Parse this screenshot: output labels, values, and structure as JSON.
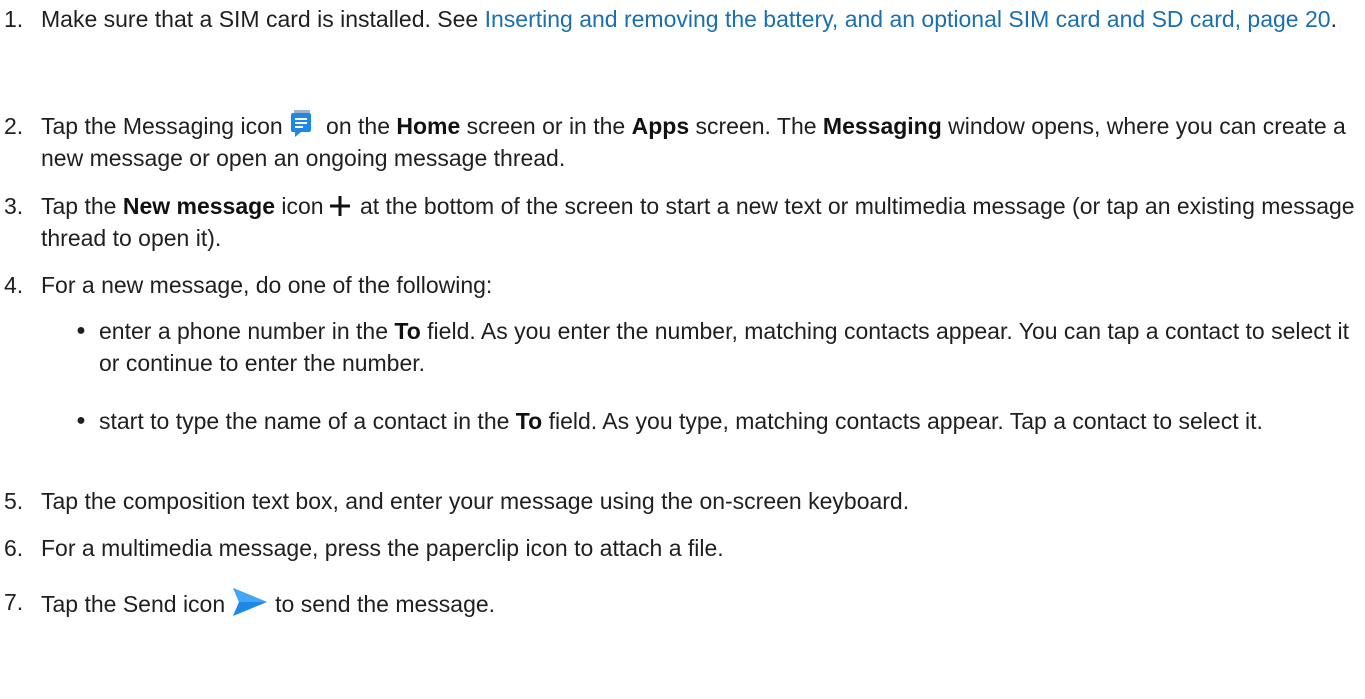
{
  "steps": {
    "s1": {
      "num": "1.",
      "text_a": "Make sure that a SIM card is installed.  See ",
      "link": "Inserting and removing the battery, and an optional SIM card and SD card, page 20",
      "text_b": "."
    },
    "s2": {
      "num": "2.",
      "t1": "Tap the Messaging icon",
      "t2": " on the ",
      "b1": "Home",
      "t3": " screen or in the ",
      "b2": "Apps",
      "t4": " screen. The ",
      "b3": "Messaging",
      "t5": " window opens, where you can create a new message or open an ongoing message thread."
    },
    "s3": {
      "num": "3.",
      "t1": "Tap the ",
      "b1": "New message",
      "t2": " icon",
      "t3": " at the bottom of the screen to start a new text or multimedia message (or tap an existing message thread to open it)."
    },
    "s4": {
      "num": "4.",
      "text": "For a new message, do one of the following:",
      "bullets": [
        {
          "t1": "enter a phone number in the ",
          "b1": "To",
          "t2": " field. As you enter the number, matching contacts appear. You can tap a contact to select it or continue to enter the number."
        },
        {
          "t1": "start to type the name of a contact in the ",
          "b1": "To",
          "t2": " field. As you type, matching contacts appear. Tap a contact to select it."
        }
      ]
    },
    "s5": {
      "num": "5.",
      "text": "Tap the composition text box, and enter your message using the on-screen keyboard."
    },
    "s6": {
      "num": "6.",
      "text": "For a multimedia message, press the paperclip icon to attach a file."
    },
    "s7": {
      "num": "7.",
      "t1": "Tap the Send icon",
      "t2": "to send the message."
    }
  },
  "colors": {
    "link": "#1a6fb0",
    "icon_blue": "#1e88e5"
  },
  "icons": {
    "messaging": "messaging-icon",
    "plus": "plus-icon",
    "send": "send-icon"
  }
}
